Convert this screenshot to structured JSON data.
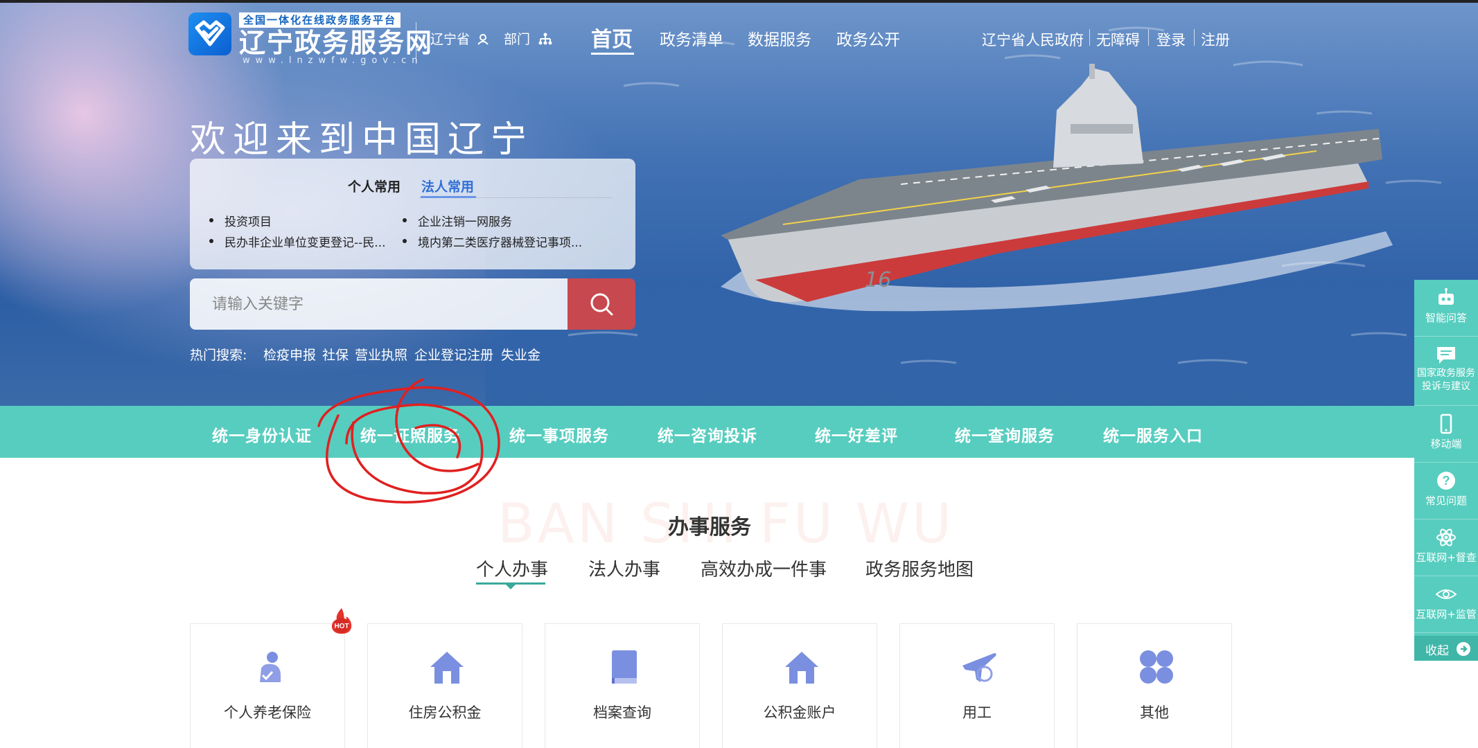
{
  "header": {
    "logo_top": "全国一体化在线政务服务平台",
    "logo_main": "辽宁政务服务网",
    "logo_url": "www.lnzwfw.gov.cn",
    "region_label": "辽宁省",
    "dept_label": "部门",
    "nav": [
      "首页",
      "政务清单",
      "数据服务",
      "政务公开"
    ],
    "top_links": [
      "辽宁省人民政府",
      "无障碍",
      "登录",
      "注册"
    ]
  },
  "hero": {
    "welcome": "欢迎来到中国辽宁",
    "tabs": [
      "个人常用",
      "法人常用"
    ],
    "active_tab": "法人常用",
    "quick_links": [
      "投资项目",
      "企业注销一网服务",
      "民办非企业单位变更登记--民...",
      "境内第二类医疗器械登记事项..."
    ],
    "search": {
      "placeholder": "请输入关键字"
    },
    "hot_label": "热门搜索:",
    "hot_terms": [
      "检疫申报",
      "社保",
      "营业执照",
      "企业登记注册",
      "失业金"
    ]
  },
  "unified_bar": [
    "统一身份认证",
    "统一证照服务",
    "统一事项服务",
    "统一咨询投诉",
    "统一好差评",
    "统一查询服务",
    "统一服务入口"
  ],
  "services": {
    "bg_title": "BAN SHI FU WU",
    "title": "办事服务",
    "tabs": [
      "个人办事",
      "法人办事",
      "高效办成一件事",
      "政务服务地图"
    ],
    "active_tab": "个人办事",
    "hot_badge": "HOT",
    "cards": [
      {
        "label": "个人养老保险",
        "icon": "elderly-care-icon"
      },
      {
        "label": "住房公积金",
        "icon": "house-icon"
      },
      {
        "label": "档案查询",
        "icon": "book-icon"
      },
      {
        "label": "公积金账户",
        "icon": "house-icon"
      },
      {
        "label": "用工",
        "icon": "plane-icon"
      },
      {
        "label": "其他",
        "icon": "clover-icon"
      }
    ]
  },
  "sidebar": {
    "items": [
      "智能问答",
      "国家政务服务投诉与建议",
      "移动端",
      "常见问题",
      "互联网+督查",
      "互联网+监管"
    ],
    "collapse": "收起"
  },
  "colors": {
    "teal": "#57cdbf",
    "search_button": "#c8484f",
    "accent_blue": "#2f6fd6",
    "annotation_red": "#e02020"
  }
}
